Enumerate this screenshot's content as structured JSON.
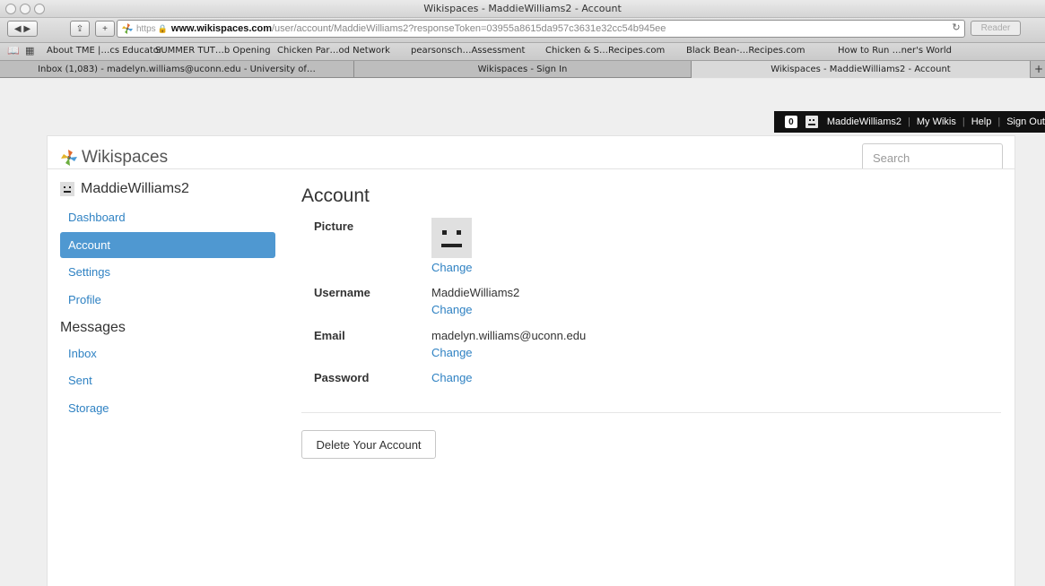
{
  "browser": {
    "window_title": "Wikispaces - MaddieWilliams2 - Account",
    "url_scheme": "https",
    "url_host": "www.wikispaces.com",
    "url_path": "/user/account/MaddieWilliams2?responseToken=03955a8615da957c3631e32cc54b945ee",
    "reader_label": "Reader",
    "bookmarks": [
      "About TME |…cs Educator",
      "SUMMER TUT…b Opening",
      "Chicken Par…od Network",
      "pearsonsch…Assessment",
      "Chicken & S…Recipes.com",
      "Black Bean-…Recipes.com",
      "How to Run …ner's World"
    ],
    "tabs": [
      {
        "title": "Inbox (1,083) - madelyn.williams@uconn.edu - University of…"
      },
      {
        "title": "Wikispaces - Sign In"
      },
      {
        "title": "Wikispaces - MaddieWilliams2 - Account"
      }
    ]
  },
  "userbar": {
    "count": "0",
    "username": "MaddieWilliams2",
    "links": [
      "My Wikis",
      "Help",
      "Sign Out"
    ]
  },
  "header": {
    "brand": "Wikispaces",
    "search_placeholder": "Search"
  },
  "sidebar": {
    "username": "MaddieWilliams2",
    "account_items": [
      "Dashboard",
      "Account",
      "Settings",
      "Profile"
    ],
    "messages_heading": "Messages",
    "message_items": [
      "Inbox",
      "Sent",
      "Storage"
    ]
  },
  "account": {
    "title": "Account",
    "picture_label": "Picture",
    "username_label": "Username",
    "username_value": "MaddieWilliams2",
    "email_label": "Email",
    "email_value": "madelyn.williams@uconn.edu",
    "password_label": "Password",
    "change_label": "Change",
    "delete_button": "Delete Your Account"
  },
  "colors": {
    "link": "#2f82c3",
    "active_nav": "#4f98d1",
    "userbar": "#111111"
  }
}
